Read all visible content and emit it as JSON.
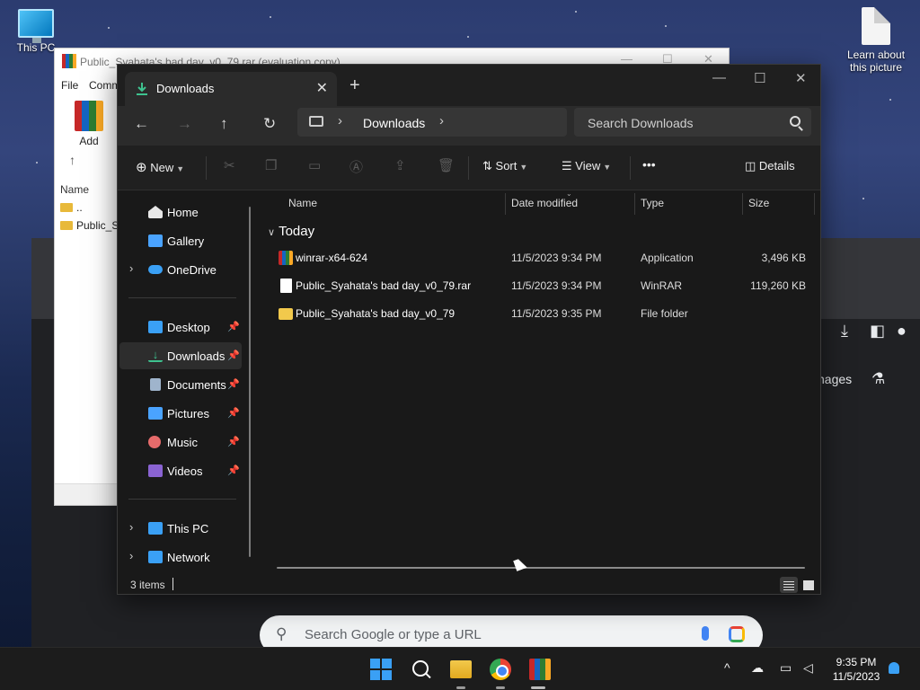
{
  "desktop": {
    "icons": [
      {
        "label": "This PC",
        "icon": "monitor-icon"
      },
      {
        "label": "Learn about this picture",
        "icon": "document-icon"
      }
    ]
  },
  "winrar": {
    "title": "Public_Syahata's bad day_v0_79.rar (evaluation copy)",
    "menu": [
      "File",
      "Comm"
    ],
    "add_label": "Add",
    "column_name": "Name",
    "rows": [
      "..",
      "Public_Sy"
    ]
  },
  "chrome": {
    "search_placeholder": "Search Google or type a URL",
    "partial_link": "nages"
  },
  "explorer": {
    "tab_title": "Downloads",
    "breadcrumb": [
      "Downloads"
    ],
    "search_placeholder": "Search Downloads",
    "toolbar": {
      "new_label": "New",
      "sort_label": "Sort",
      "view_label": "View",
      "more_label": "•••",
      "details_label": "Details"
    },
    "nav": {
      "items": [
        {
          "label": "Home",
          "color": "#e8e8e8"
        },
        {
          "label": "Gallery",
          "color": "#4aa3ff"
        },
        {
          "label": "OneDrive",
          "color": "#3aa0f5",
          "expandable": true
        },
        {
          "label": "Desktop",
          "color": "#3aa0f5",
          "pinned": true
        },
        {
          "label": "Downloads",
          "color": "#3ec28f",
          "pinned": true,
          "selected": true
        },
        {
          "label": "Documents",
          "color": "#9fb4cc",
          "pinned": true
        },
        {
          "label": "Pictures",
          "color": "#4aa3ff",
          "pinned": true
        },
        {
          "label": "Music",
          "color": "#e66b6b",
          "pinned": true
        },
        {
          "label": "Videos",
          "color": "#8a63d2",
          "pinned": true
        },
        {
          "label": "This PC",
          "color": "#3aa0f5",
          "expandable": true
        },
        {
          "label": "Network",
          "color": "#3aa0f5",
          "expandable": true
        }
      ]
    },
    "columns": [
      "Name",
      "Date modified",
      "Type",
      "Size"
    ],
    "group_label": "Today",
    "files": [
      {
        "name": "winrar-x64-624",
        "date": "11/5/2023 9:34 PM",
        "type": "Application",
        "size": "3,496 KB",
        "icon": "winrar-app-icon"
      },
      {
        "name": "Public_Syahata's bad day_v0_79.rar",
        "date": "11/5/2023 9:34 PM",
        "type": "WinRAR",
        "size": "119,260 KB",
        "icon": "file-icon"
      },
      {
        "name": "Public_Syahata's bad day_v0_79",
        "date": "11/5/2023 9:35 PM",
        "type": "File folder",
        "size": "",
        "icon": "folder-icon"
      }
    ],
    "status_count": "3 items"
  },
  "taskbar": {
    "clock_time": "9:35 PM",
    "clock_date": "11/5/2023"
  }
}
